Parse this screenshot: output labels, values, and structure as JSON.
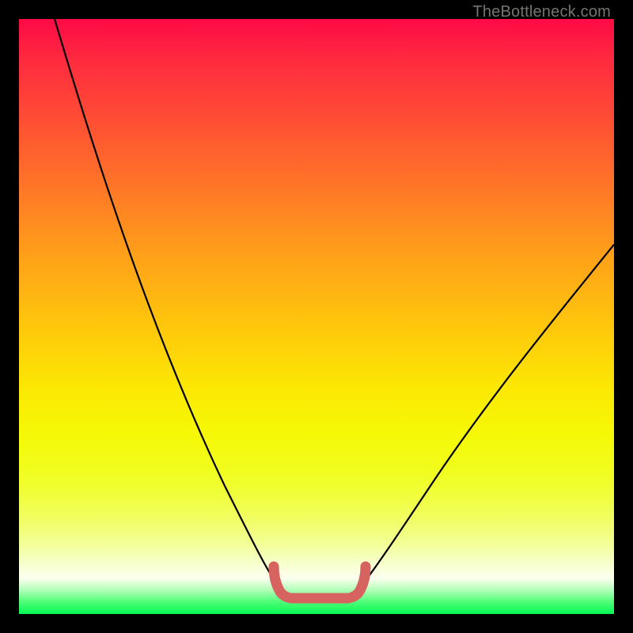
{
  "watermark": "TheBottleneck.com",
  "chart_data": {
    "type": "line",
    "title": "",
    "xlabel": "",
    "ylabel": "",
    "xlim": [
      0,
      100
    ],
    "ylim": [
      0,
      100
    ],
    "series": [
      {
        "name": "bottleneck-curve",
        "x": [
          6,
          10,
          15,
          20,
          25,
          30,
          35,
          40,
          43,
          45,
          47,
          50,
          53,
          55,
          57,
          60,
          65,
          70,
          75,
          80,
          85,
          90,
          95,
          100
        ],
        "y": [
          100,
          88,
          75,
          62,
          50,
          39,
          28,
          17,
          9,
          4,
          3,
          3,
          3,
          4,
          9,
          15,
          23,
          30,
          37,
          43,
          49,
          55,
          60,
          65
        ]
      }
    ],
    "annotations": [
      {
        "name": "optimal-zone-marker",
        "x_range": [
          43,
          57
        ],
        "y": 3
      }
    ],
    "colors": {
      "gradient_top": "#fe0a46",
      "gradient_bottom": "#05f854",
      "curve": "#000000",
      "marker": "#d76360"
    }
  }
}
